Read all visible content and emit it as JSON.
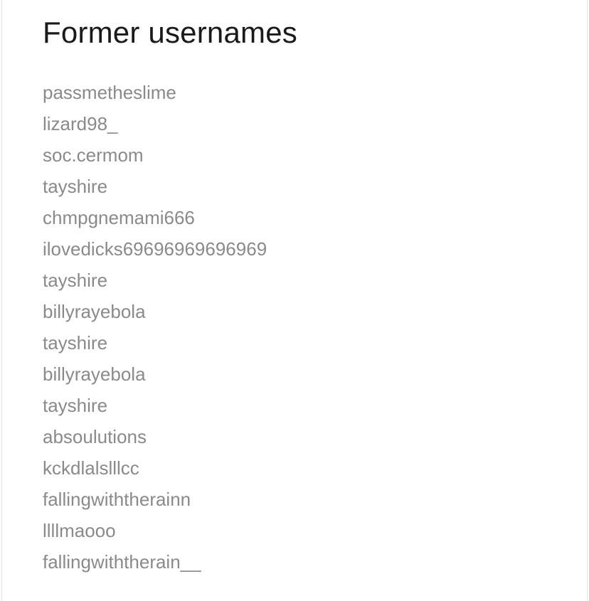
{
  "section": {
    "title": "Former usernames"
  },
  "usernames": [
    "passmetheslime",
    "lizard98_",
    "soc.cermom",
    "tayshire",
    "chmpgnemami666",
    "ilovedicks69696969696969",
    "tayshire",
    "billyrayebola",
    "tayshire",
    "billyrayebola",
    "tayshire",
    "absoulutions",
    "kckdlalslllcc",
    "fallingwiththerainn",
    "llllmaooo",
    "fallingwiththerain__"
  ]
}
